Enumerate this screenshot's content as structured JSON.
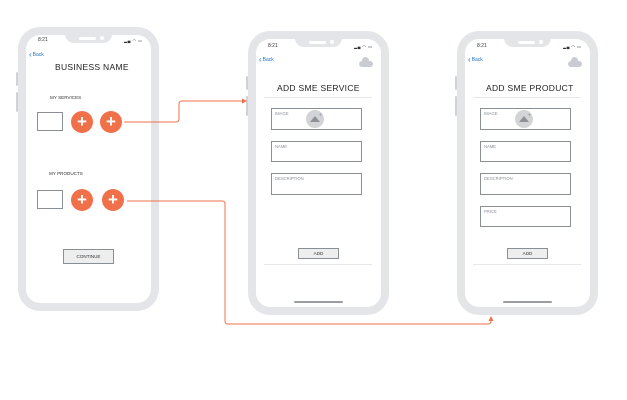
{
  "status_time": "8:21",
  "status_icons": "▂▄ ◠ ▭",
  "back_label": "Back",
  "screen1": {
    "title": "BUSINESS NAME",
    "services_label": "MY SERVICES",
    "products_label": "MY PRODUCTS",
    "plus_symbol": "+",
    "continue_label": "CONTINUE"
  },
  "screen2": {
    "title": "ADD SME SERVICE",
    "image_placeholder": "IMAGE",
    "name_placeholder": "NAME",
    "description_placeholder": "DESCRIPTION",
    "add_label": "ADD"
  },
  "screen3": {
    "title": "ADD SME PRODUCT",
    "image_placeholder": "IMAGE",
    "name_placeholder": "NAME",
    "description_placeholder": "DESCRIPTION",
    "price_placeholder": "PRICE",
    "add_label": "ADD"
  },
  "connector_color": "#f0704a"
}
